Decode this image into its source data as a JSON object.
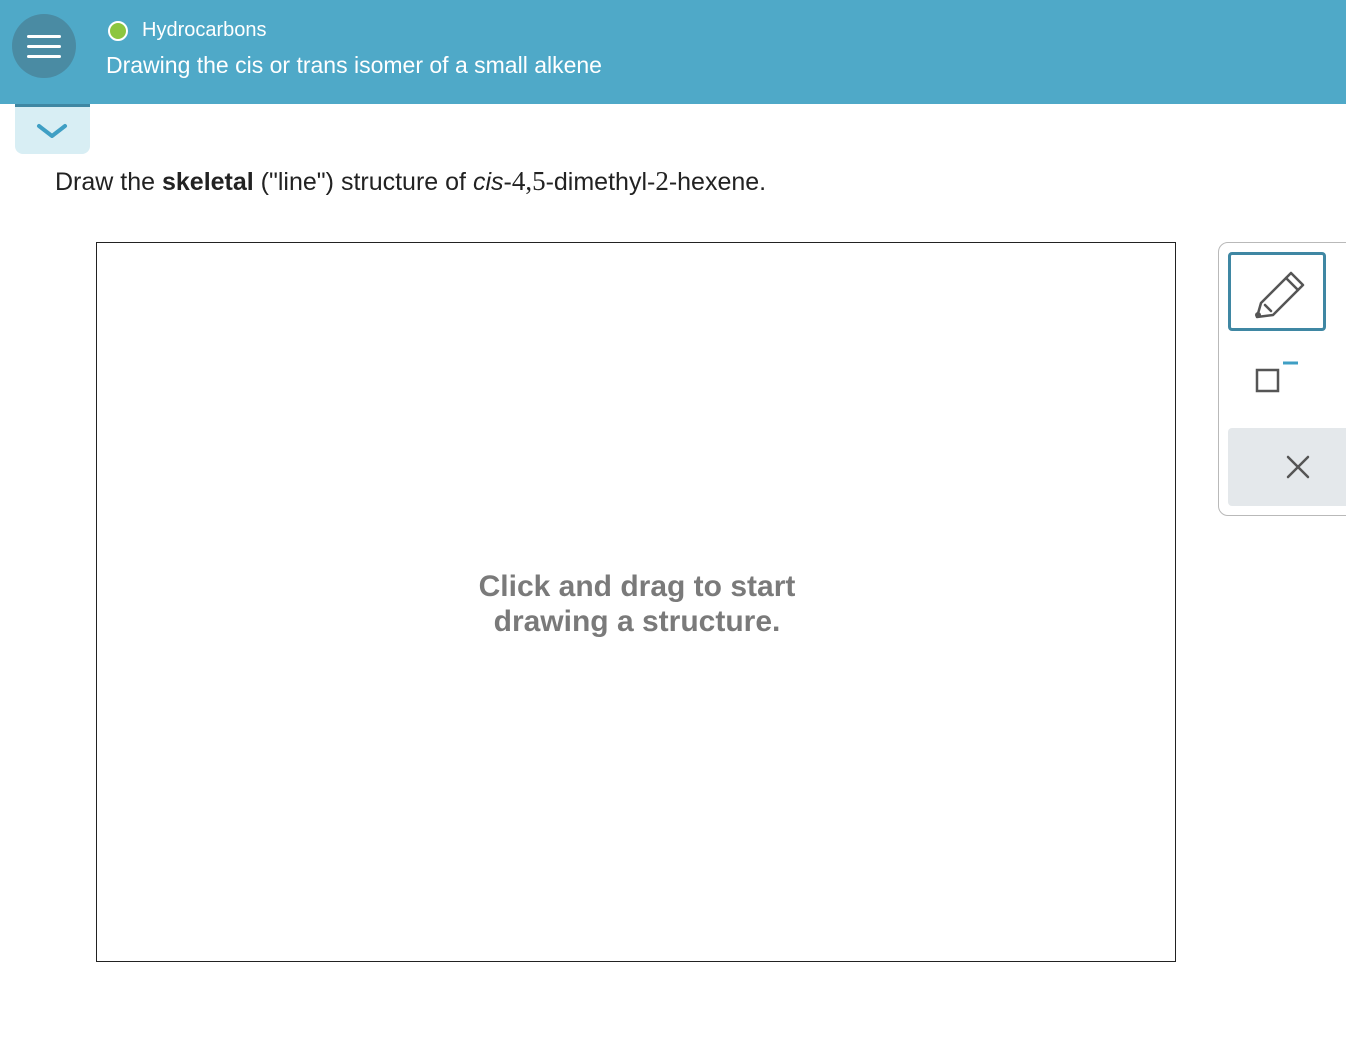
{
  "header": {
    "topic": "Hydrocarbons",
    "subtitle": "Drawing the cis or trans isomer of a small alkene",
    "topic_status_color": "#8cc63f",
    "background_color": "#4fa9c8"
  },
  "question": {
    "part1": "Draw the ",
    "bold": "skeletal",
    "part2": " (\"line\") structure of ",
    "italic": "cis",
    "dash1": "-",
    "num1": "4,5",
    "part3": "-dimethyl-",
    "num2": "2",
    "part4": "-hexene."
  },
  "canvas": {
    "hint": "Click and drag to start drawing a structure."
  },
  "toolbar": {
    "tools": [
      "pencil-icon",
      "charge-icon",
      "close-icon"
    ],
    "accent_color": "#3f87a3"
  },
  "icons": {
    "menu": "menu-icon",
    "collapse": "chevron-down-icon"
  }
}
